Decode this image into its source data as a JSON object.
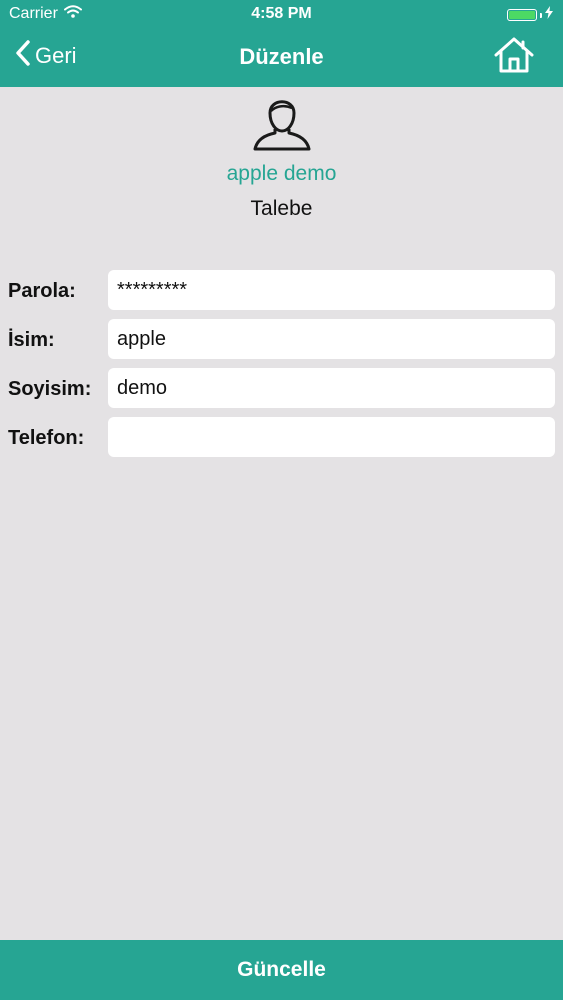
{
  "status_bar": {
    "carrier": "Carrier",
    "time": "4:58 PM",
    "battery_color": "#4cd964"
  },
  "nav": {
    "back_label": "Geri",
    "title": "Düzenle",
    "back_icon": "chevron-left-icon",
    "home_icon": "home-icon"
  },
  "profile": {
    "avatar_icon": "user-avatar-icon",
    "name": "apple demo",
    "role": "Talebe"
  },
  "form": {
    "fields": [
      {
        "label": "Parola:",
        "value": "*********"
      },
      {
        "label": "İsim:",
        "value": "apple"
      },
      {
        "label": "Soyisim:",
        "value": "demo"
      },
      {
        "label": "Telefon:",
        "value": ""
      }
    ]
  },
  "footer": {
    "submit_label": "Güncelle"
  },
  "colors": {
    "accent": "#26a593",
    "background": "#e4e2e4"
  }
}
